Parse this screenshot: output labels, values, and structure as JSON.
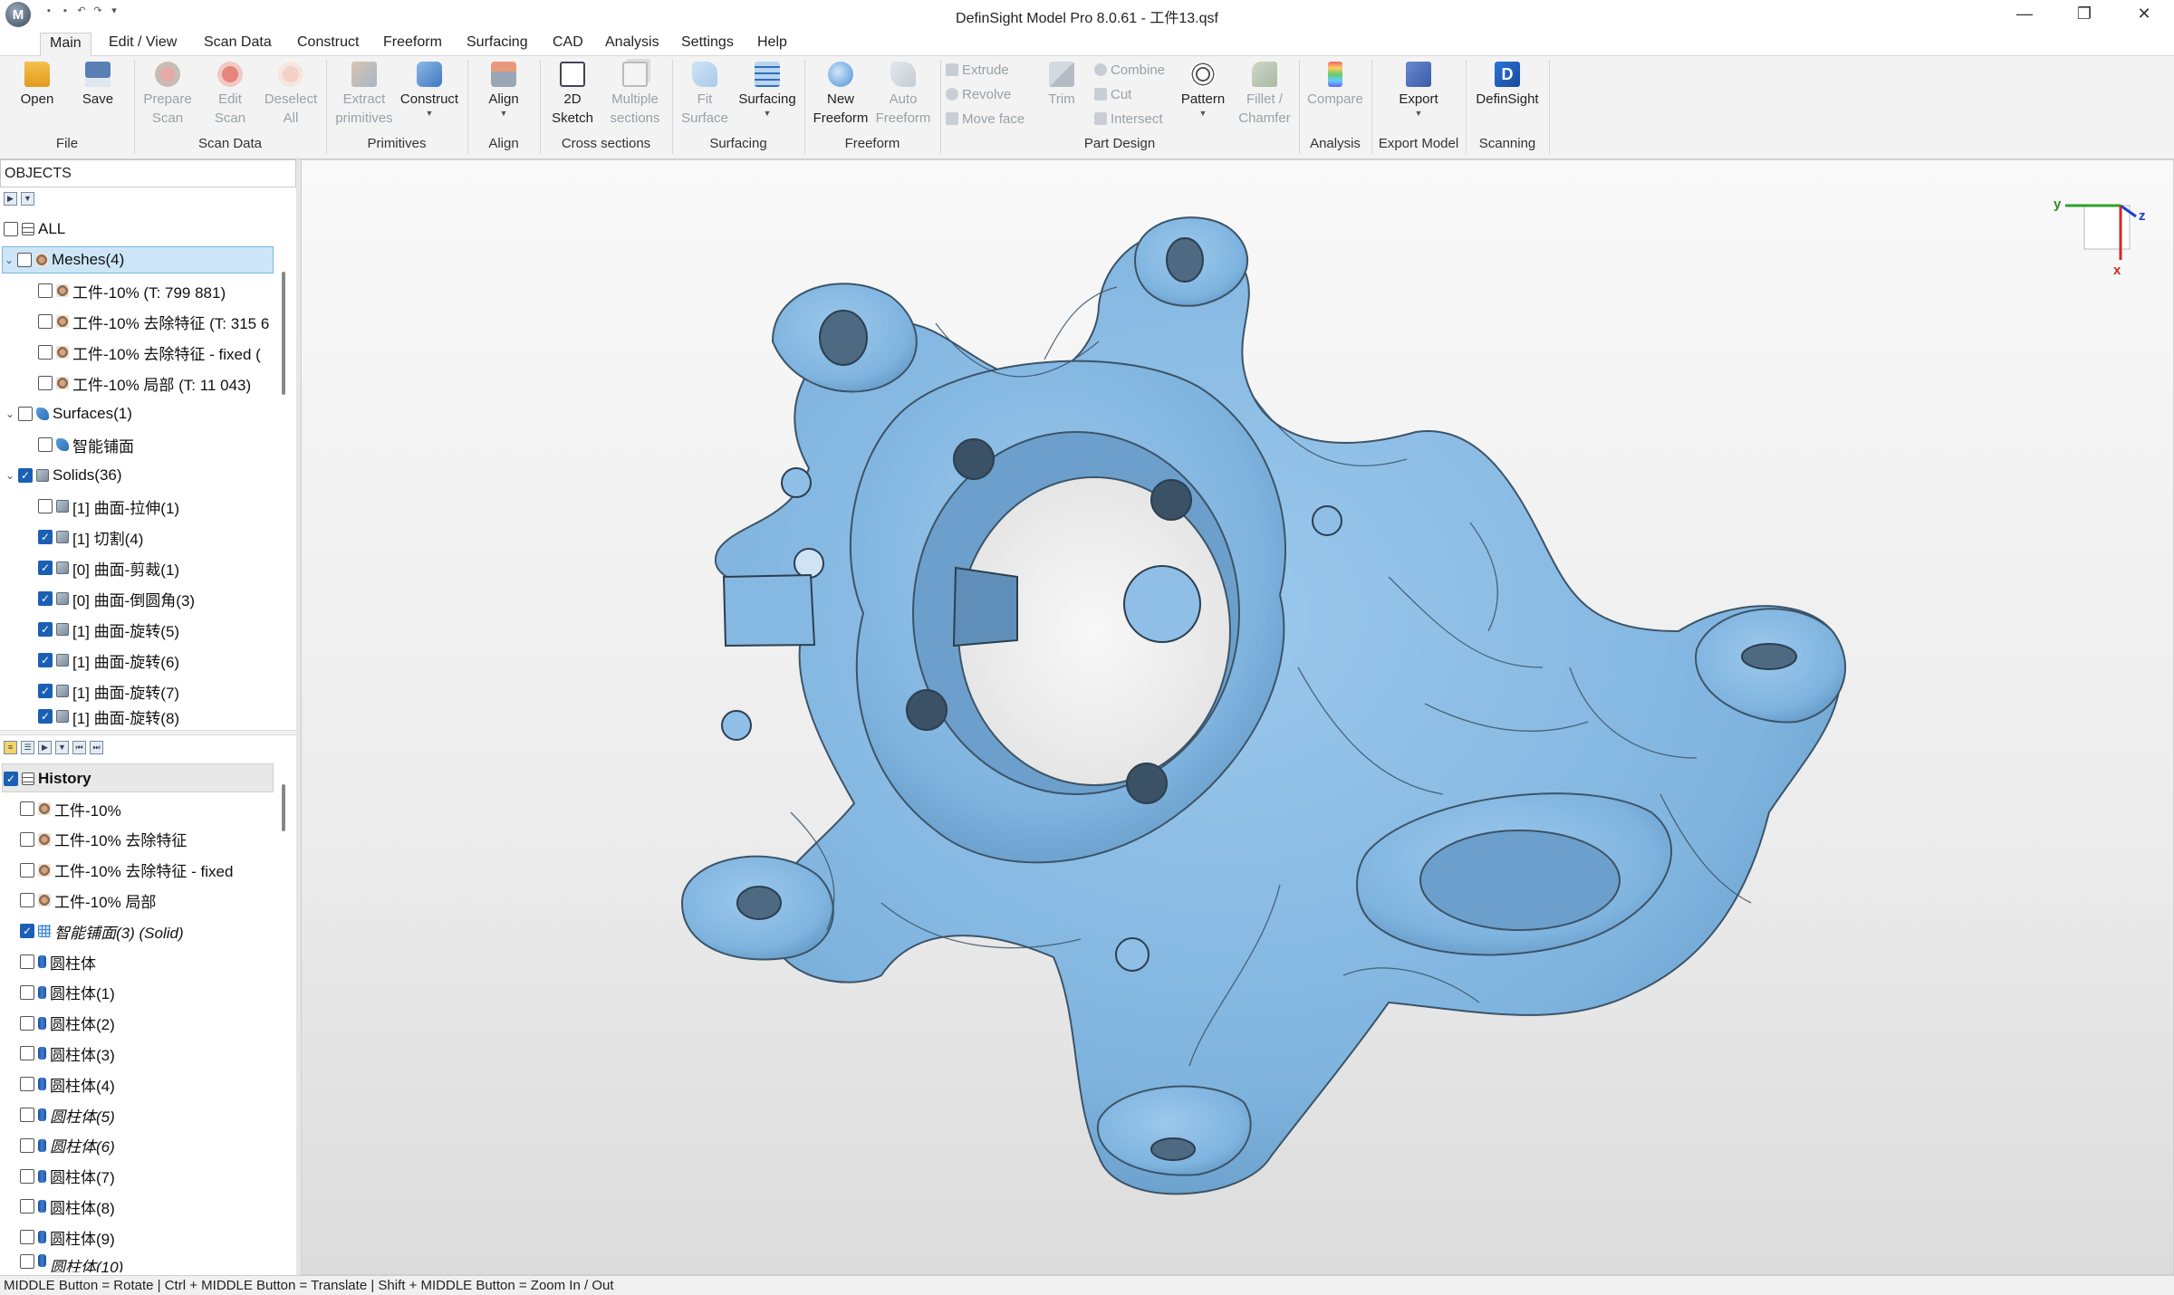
{
  "app": {
    "title": "DefinSight Model Pro 8.0.61 - 工件13.qsf",
    "logo": "M"
  },
  "menu": {
    "tabs": [
      "Main",
      "Edit / View",
      "Scan Data",
      "Construct",
      "Freeform",
      "Surfacing",
      "CAD",
      "Analysis",
      "Settings",
      "Help"
    ],
    "active": "Main"
  },
  "ribbon": {
    "open": "Open",
    "save": "Save",
    "prepare_scan": "Prepare\nScan",
    "edit_scan": "Edit\nScan",
    "deselect_all": "Deselect\nAll",
    "extract_primitives": "Extract\nprimitives",
    "construct": "Construct",
    "align": "Align",
    "sketch_2d": "2D\nSketch",
    "multiple_sections": "Multiple\nsections",
    "fit_surface": "Fit\nSurface",
    "surfacing": "Surfacing",
    "new_freeform": "New\nFreeform",
    "auto_freeform": "Auto\nFreeform",
    "extrude": "Extrude",
    "revolve": "Revolve",
    "move_face": "Move face",
    "trim": "Trim",
    "combine": "Combine",
    "cut": "Cut",
    "intersect": "Intersect",
    "pattern": "Pattern",
    "fillet_chamfer": "Fillet /\nChamfer",
    "compare": "Compare",
    "export": "Export",
    "definsight": "DefinSight",
    "groups": {
      "file": "File",
      "scan_data": "Scan Data",
      "primitives": "Primitives",
      "align": "Align",
      "cross_sections": "Cross sections",
      "surfacing": "Surfacing",
      "freeform": "Freeform",
      "part_design": "Part Design",
      "analysis": "Analysis",
      "export_model": "Export Model",
      "scanning": "Scanning"
    }
  },
  "objects": {
    "header": "OBJECTS",
    "all": "ALL",
    "meshes": {
      "label": "Meshes(4)",
      "items": [
        "工件-10% (T: 799 881)",
        "工件-10% 去除特征 (T: 315 6",
        "工件-10% 去除特征 - fixed (",
        "工件-10% 局部 (T: 11 043)"
      ]
    },
    "surfaces": {
      "label": "Surfaces(1)",
      "items": [
        "智能铺面"
      ]
    },
    "solids": {
      "label": "Solids(36)",
      "items": [
        {
          "label": "[1] 曲面-拉伸(1)",
          "checked": false
        },
        {
          "label": "[1] 切割(4)",
          "checked": true
        },
        {
          "label": "[0] 曲面-剪裁(1)",
          "checked": true
        },
        {
          "label": "[0] 曲面-倒圆角(3)",
          "checked": true
        },
        {
          "label": "[1] 曲面-旋转(5)",
          "checked": true
        },
        {
          "label": "[1] 曲面-旋转(6)",
          "checked": true
        },
        {
          "label": "[1] 曲面-旋转(7)",
          "checked": true
        },
        {
          "label": "[1] 曲面-旋转(8)",
          "checked": true
        }
      ]
    }
  },
  "history": {
    "header": "History",
    "items": [
      {
        "label": "工件-10%",
        "type": "mesh",
        "checked": false,
        "italic": false
      },
      {
        "label": "工件-10% 去除特征",
        "type": "mesh",
        "checked": false,
        "italic": false
      },
      {
        "label": "工件-10% 去除特征 - fixed",
        "type": "mesh",
        "checked": false,
        "italic": false
      },
      {
        "label": "工件-10% 局部",
        "type": "mesh",
        "checked": false,
        "italic": false
      },
      {
        "label": "智能铺面(3) (Solid)",
        "type": "grid",
        "checked": true,
        "italic": true
      },
      {
        "label": "圆柱体",
        "type": "cyl",
        "checked": false,
        "italic": false
      },
      {
        "label": "圆柱体(1)",
        "type": "cyl",
        "checked": false,
        "italic": false
      },
      {
        "label": "圆柱体(2)",
        "type": "cyl",
        "checked": false,
        "italic": false
      },
      {
        "label": "圆柱体(3)",
        "type": "cyl",
        "checked": false,
        "italic": false
      },
      {
        "label": "圆柱体(4)",
        "type": "cyl",
        "checked": false,
        "italic": false
      },
      {
        "label": "圆柱体(5)",
        "type": "cyl",
        "checked": false,
        "italic": true
      },
      {
        "label": "圆柱体(6)",
        "type": "cyl",
        "checked": false,
        "italic": true
      },
      {
        "label": "圆柱体(7)",
        "type": "cyl",
        "checked": false,
        "italic": false
      },
      {
        "label": "圆柱体(8)",
        "type": "cyl",
        "checked": false,
        "italic": false
      },
      {
        "label": "圆柱体(9)",
        "type": "cyl",
        "checked": false,
        "italic": false
      },
      {
        "label": "圆柱体(10)",
        "type": "cyl",
        "checked": false,
        "italic": true
      }
    ]
  },
  "axes": {
    "x": "x",
    "y": "y",
    "z": "z"
  },
  "status": "MIDDLE Button = Rotate | Ctrl + MIDDLE Button = Translate | Shift + MIDDLE Button = Zoom In / Out",
  "colors": {
    "model": "#7fb4df",
    "accent": "#1a5fb4",
    "selection": "#cde6f7"
  }
}
